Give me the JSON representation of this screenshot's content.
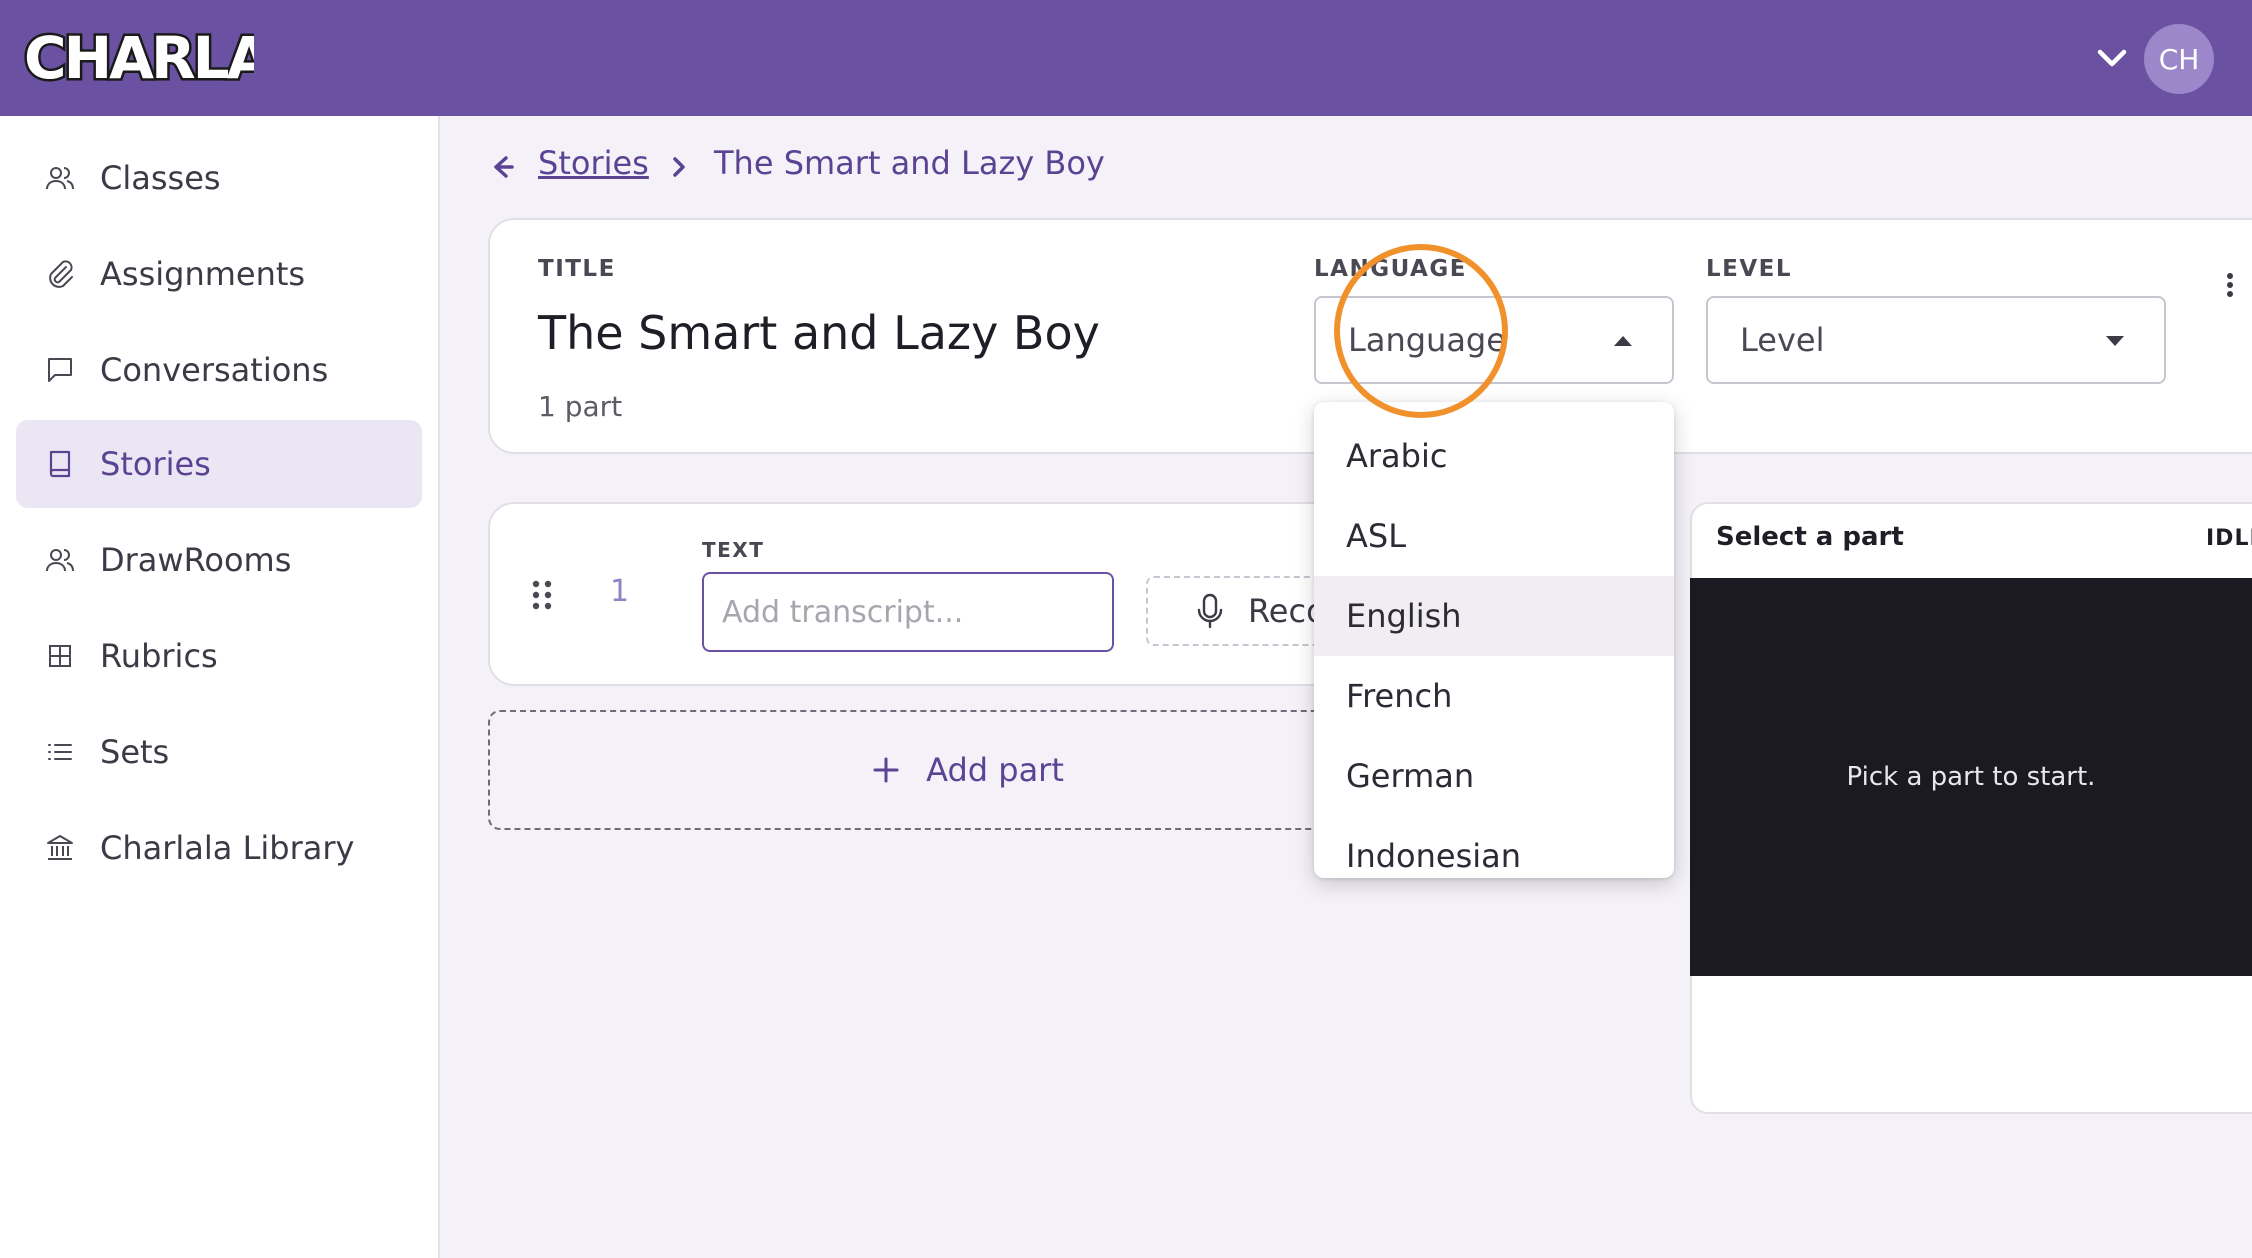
{
  "app": {
    "logo_text": "CHARLALA",
    "user_initials": "CH",
    "colors": {
      "brand": "#6a51a1",
      "accent": "#5b4394",
      "annotation": "#f0912c",
      "stage": "#1b1a22"
    }
  },
  "sidebar": {
    "items": [
      {
        "label": "Classes",
        "icon": "users-icon"
      },
      {
        "label": "Assignments",
        "icon": "paperclip-icon"
      },
      {
        "label": "Conversations",
        "icon": "chat-bubble-icon"
      },
      {
        "label": "Stories",
        "icon": "book-icon",
        "active": true
      },
      {
        "label": "DrawRooms",
        "icon": "users-icon"
      },
      {
        "label": "Rubrics",
        "icon": "grid-icon"
      },
      {
        "label": "Sets",
        "icon": "list-icon"
      },
      {
        "label": "Charlala Library",
        "icon": "library-icon"
      }
    ]
  },
  "breadcrumb": {
    "parent": "Stories",
    "current": "The Smart and Lazy Boy"
  },
  "story": {
    "title_label": "TITLE",
    "title": "The Smart and Lazy Boy",
    "parts_count": "1 part",
    "language_label": "LANGUAGE",
    "language_value": "Language",
    "level_label": "LEVEL",
    "level_value": "Level"
  },
  "language_options": [
    "Arabic",
    "ASL",
    "English",
    "French",
    "German",
    "Indonesian"
  ],
  "part": {
    "number": "1",
    "text_label": "TEXT",
    "transcript_placeholder": "Add transcript...",
    "transcript_value": "",
    "record_label": "Record"
  },
  "add_part_label": "Add part",
  "preview": {
    "title": "Select a part",
    "status": "IDLE",
    "message": "Pick a part to start."
  }
}
